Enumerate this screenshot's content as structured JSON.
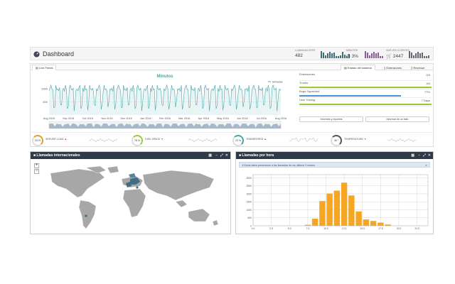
{
  "header": {
    "title": "Dashboard",
    "stats": [
      {
        "label": "LLAMADAS ATER",
        "value": "482",
        "icon": ""
      },
      {
        "label": "MINUTOS",
        "value": "3%",
        "icon": "clock-icon"
      },
      {
        "label": "NUEVOS CLIENTES",
        "value": "2447",
        "icon": "cart-icon"
      }
    ]
  },
  "tabs": {
    "left": "Live Feeds",
    "right": [
      "Estado del sistema",
      "Extensiones",
      "Revenue"
    ]
  },
  "chart_data": [
    {
      "type": "area",
      "title": "Minutos",
      "legend": "llamadas",
      "ylim": [
        0,
        1300
      ],
      "yticks": [
        "1000",
        "500"
      ],
      "xticks": [
        "Aug 2015",
        "Sep 2015",
        "Oct 2015",
        "Nov 2015",
        "Dec 2015",
        "Jan 2016",
        "Feb 2016",
        "Mar 2016",
        "Apr 2016",
        "May 2016",
        "Jun 2016",
        "Jul 2016",
        "Aug 2016"
      ],
      "color": "#4aa3a6"
    },
    {
      "type": "bar",
      "title": "Llamadas por hora",
      "categories": [
        "0.0",
        "2.5",
        "5.0",
        "7.5",
        "10.0",
        "12.5",
        "15.0",
        "17.5",
        "20.0",
        "22.5"
      ],
      "x": [
        7.5,
        8.5,
        9.5,
        10.5,
        11.5,
        12.5,
        13.5,
        14.5,
        15.5,
        16.5,
        17.5,
        18.5
      ],
      "values": [
        60,
        450,
        1550,
        2020,
        2200,
        2700,
        1900,
        900,
        400,
        300,
        200,
        80
      ],
      "yticks": [
        "3000",
        "2500",
        "2000",
        "1500",
        "1000",
        "500",
        "0"
      ],
      "ylim": [
        0,
        3200
      ],
      "color": "#f5a623"
    }
  ],
  "system": {
    "rows": [
      {
        "label": "Extensiones",
        "value": "0/3",
        "pct": 0,
        "color": "#9c3"
      },
      {
        "label": "Trunks",
        "value": "4/4",
        "pct": 100,
        "color": "#9c3"
      },
      {
        "label": "Bugs Squashed",
        "value": "77%",
        "pct": 77,
        "color": "#4a90d9"
      },
      {
        "label": "User Testing",
        "value": "7 Days",
        "pct": 100,
        "color": "#9c3"
      }
    ],
    "btn1": "Informes y reportes",
    "btn2": "Informar de un fallo"
  },
  "gauges": [
    {
      "pct": "33 %",
      "label": "SERVER LOAD",
      "badge": "▲",
      "color": "#e49f2a"
    },
    {
      "pct": "78 %",
      "label": "DISK SPACE",
      "badge": "▼",
      "color": "#9c3"
    },
    {
      "pct": "23 %",
      "label": "TRANSFERED",
      "badge": "▲",
      "color": "#4aa3a6"
    },
    {
      "pct": "36 °",
      "label": "TEMPERATURE",
      "badge": "▼",
      "color": "#555"
    }
  ],
  "widgets": {
    "intl": {
      "title": "Llamadas internacionales"
    },
    "hour": {
      "title": "Llamadas por hora",
      "info": "Estos datos pertenecen a las llamadas de los últimos 3 meses."
    }
  }
}
